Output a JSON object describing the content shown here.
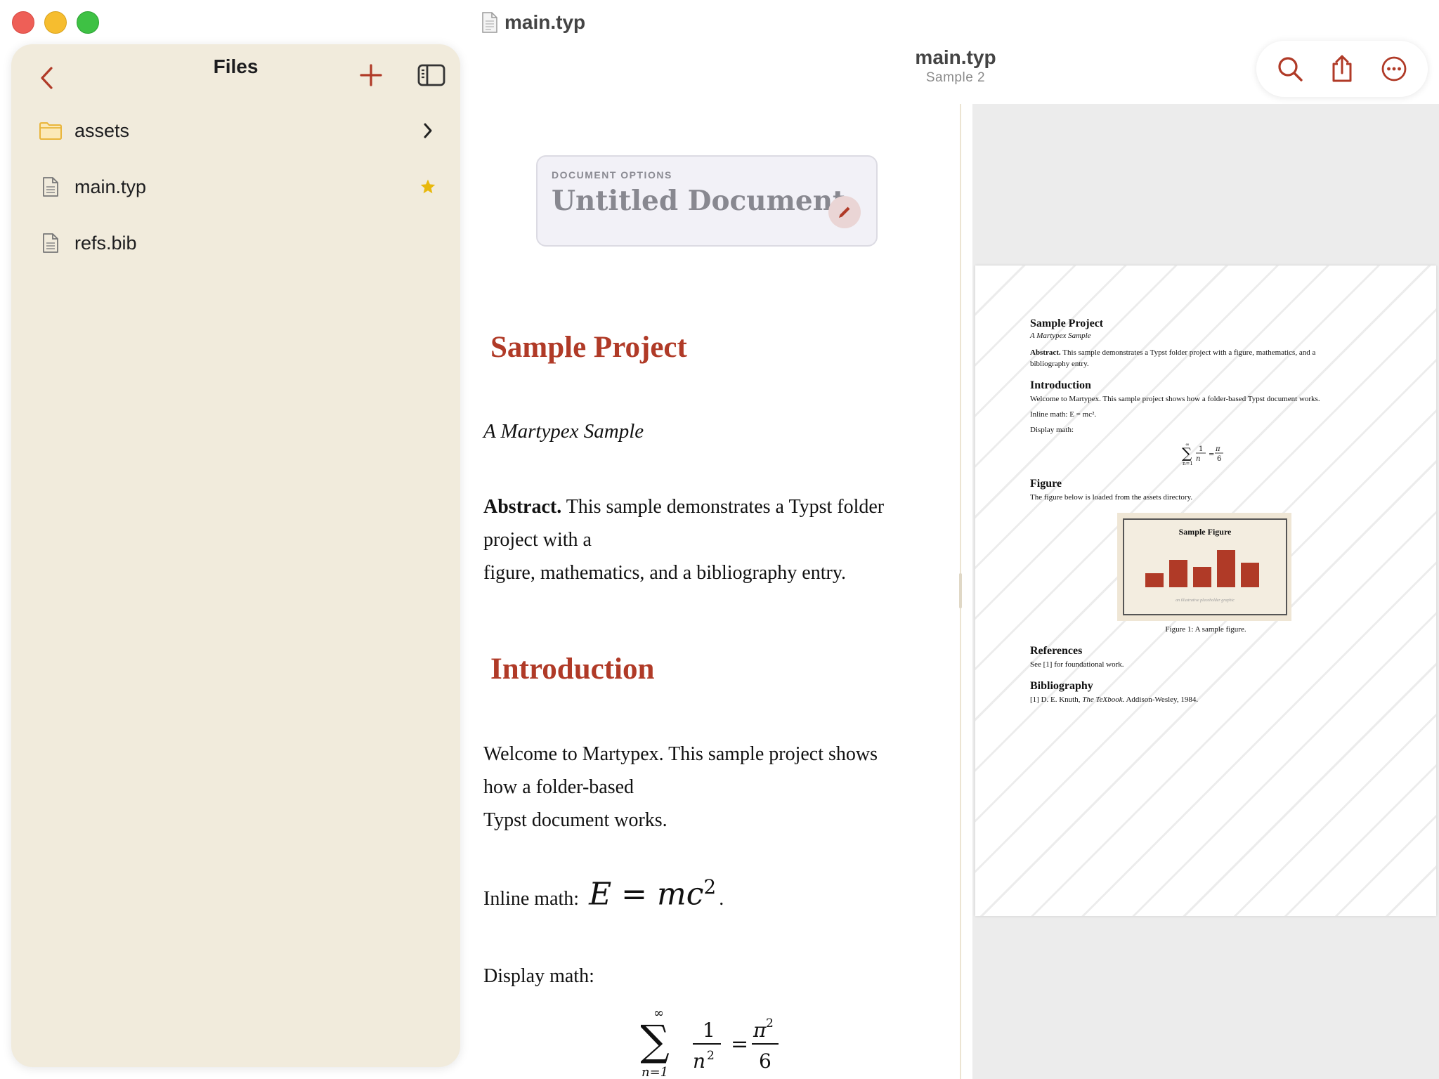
{
  "window": {
    "title": "main.typ"
  },
  "sidebar": {
    "title": "Files",
    "items": [
      {
        "name": "assets",
        "icon": "folder-icon",
        "trailing": "chevron-right-icon"
      },
      {
        "name": "main.typ",
        "icon": "document-icon",
        "trailing": "star-icon"
      },
      {
        "name": "refs.bib",
        "icon": "document-icon",
        "trailing": ""
      }
    ]
  },
  "header": {
    "title": "main.typ",
    "subtitle": "Sample 2"
  },
  "toolbar": {
    "icons": [
      "search-icon",
      "share-icon",
      "more-icon"
    ]
  },
  "colors": {
    "accent": "#b03a27",
    "sidebar_bg": "#f1ebdc",
    "star": "#e8b80c",
    "folder": "#e9b53b"
  },
  "document_options": {
    "label": "DOCUMENT OPTIONS",
    "title": "Untitled Document"
  },
  "editor": {
    "title": "Sample Project",
    "subtitle": "A Martypex Sample",
    "abstract_label": "Abstract.",
    "abstract_text": [
      " This sample demonstrates a Typst folder",
      "project with a",
      "figure, mathematics, and a bibliography entry."
    ],
    "intro_heading": "Introduction",
    "intro_text": [
      "Welcome to Martypex. This sample project shows",
      "how a folder-based",
      "Typst document works."
    ],
    "inline_math_label": "Inline math:",
    "inline_math_expr": "E = mc",
    "inline_math_exp": "2",
    "display_math_label": "Display math:",
    "display_math": {
      "sum_top": "∞",
      "sum_bottom": "n=1",
      "num": "1",
      "den": "n",
      "den_exp": "2",
      "rhs_num": "π",
      "rhs_num_exp": "2",
      "rhs_den": "6"
    }
  },
  "preview": {
    "title": "Sample Project",
    "subtitle": "A Martypex Sample",
    "abstract_label": "Abstract.",
    "abstract_line1": " This sample demonstrates a Typst folder project with a figure, mathematics, and a",
    "abstract_line2": "bibliography entry.",
    "intro_heading": "Introduction",
    "intro_text": "Welcome to Martypex. This sample project shows how a folder-based Typst document works.",
    "inline_math": "Inline math: E = mc².",
    "display_math_label": "Display math:",
    "figure_heading": "Figure",
    "figure_text": "The figure below is loaded from the assets directory.",
    "figure_inner_title": "Sample Figure",
    "figure_inner_note": "an illustrative placeholder graphic",
    "figure_caption": "Figure 1: A sample figure.",
    "references_heading": "References",
    "references_text": "See [1] for foundational work.",
    "bibliography_heading": "Bibliography",
    "bib_prefix": "[1]  D. E. Knuth, ",
    "bib_title": "The TeXbook.",
    "bib_suffix": " Addison-Wesley, 1984.",
    "figure_bars": [
      0.35,
      0.7,
      0.52,
      0.95,
      0.62
    ]
  }
}
